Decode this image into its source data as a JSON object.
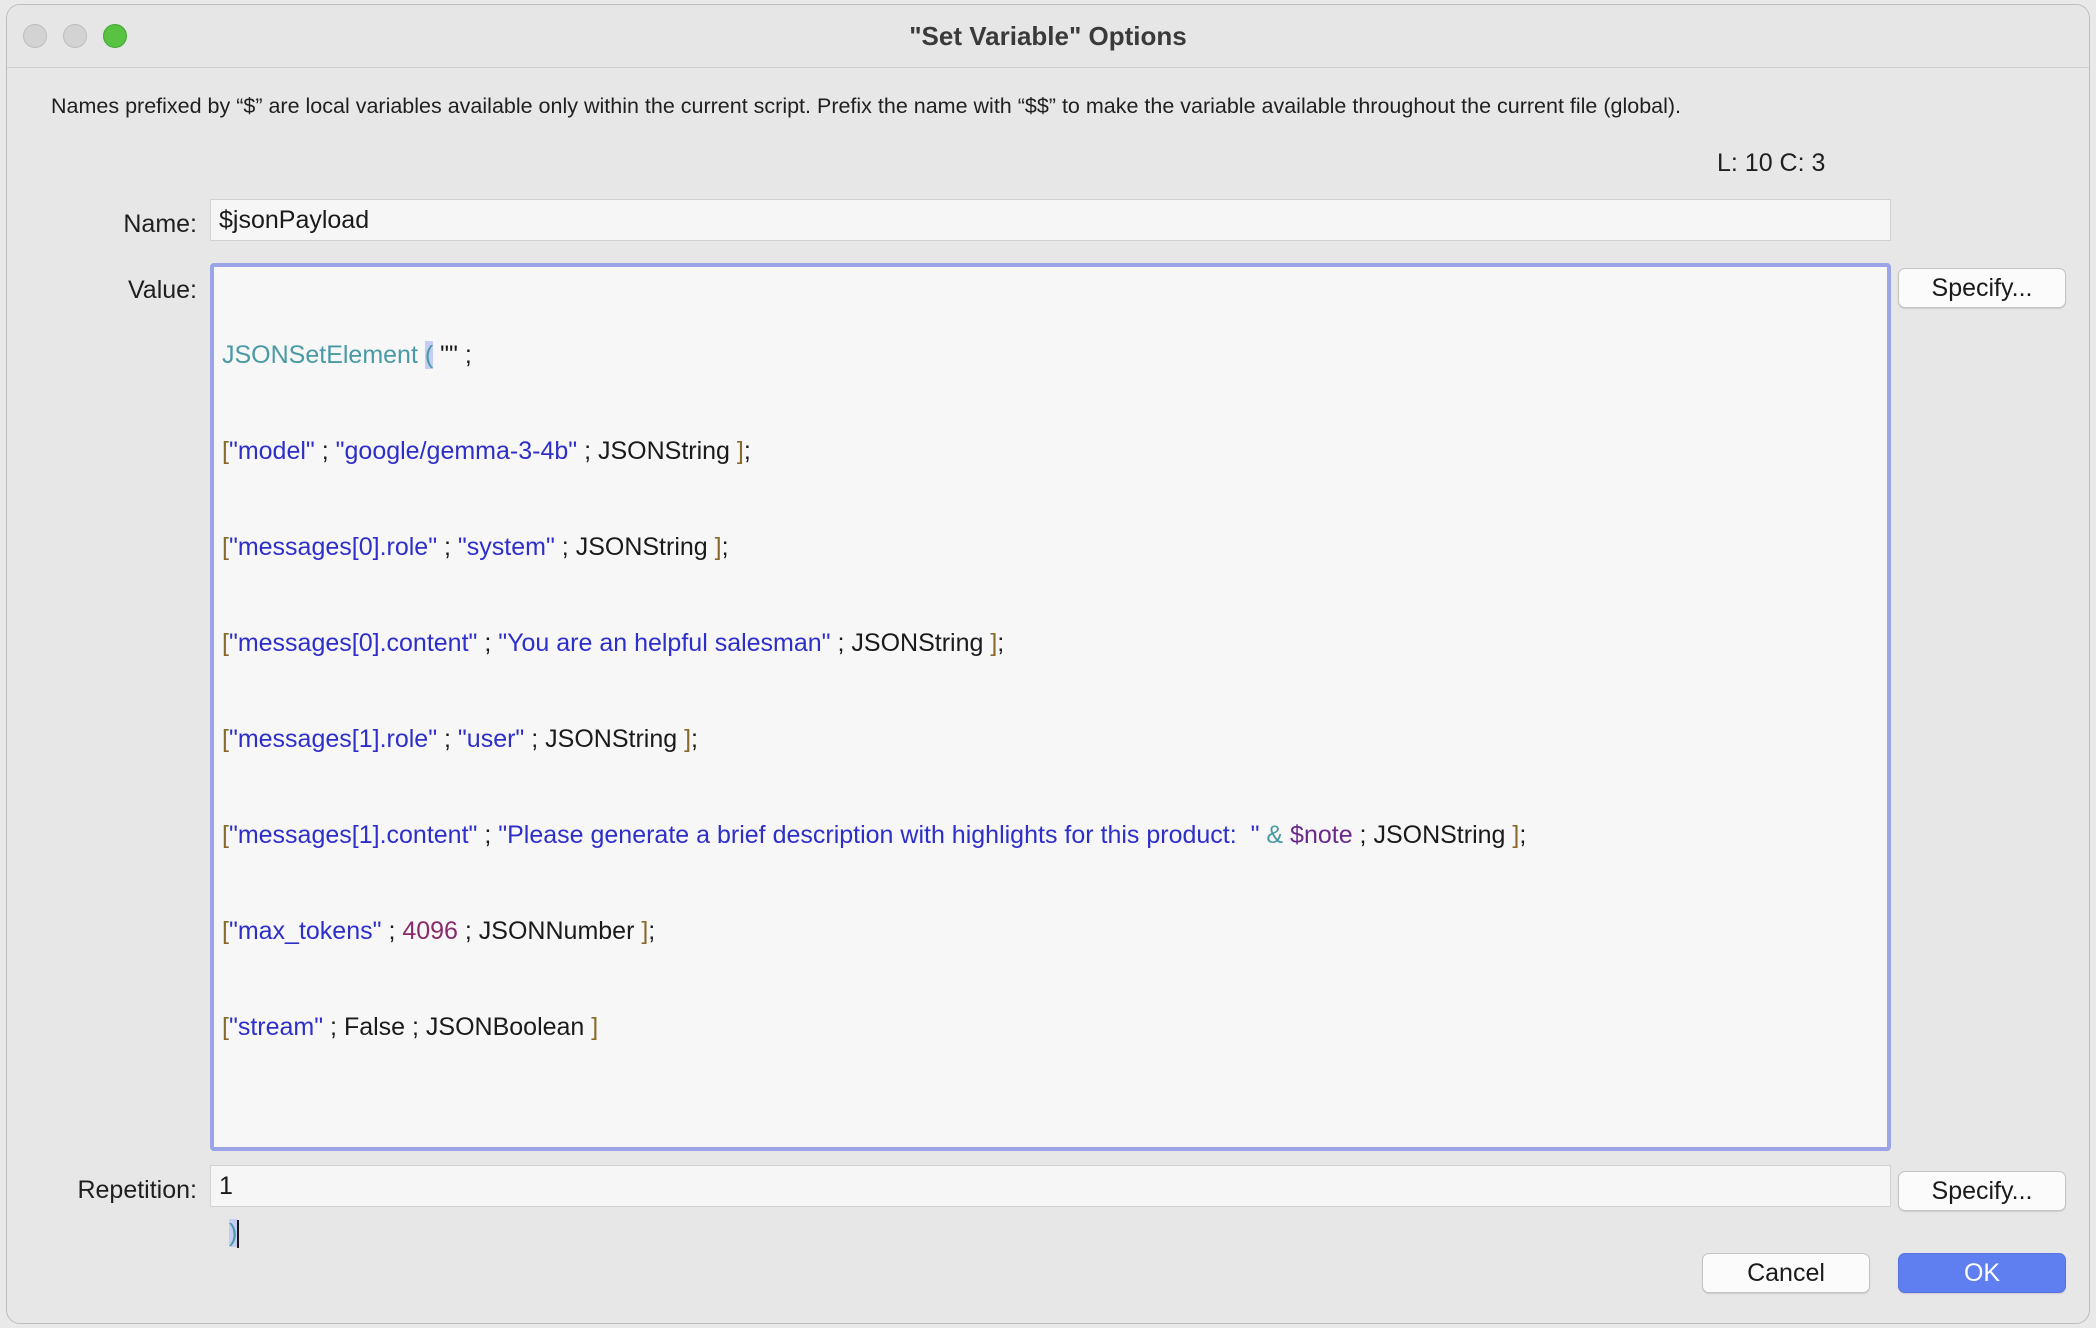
{
  "window": {
    "title": "\"Set Variable\" Options"
  },
  "info_text": "Names prefixed by “$” are local variables available only within the current script. Prefix the name with “$$” to make the variable available throughout the current file (global).",
  "cursor_position": "L: 10 C: 3",
  "name": {
    "label": "Name:",
    "value": "$jsonPayload"
  },
  "value": {
    "label": "Value:",
    "lines": [
      "JSONSetElement ( \"\" ;",
      "[\"model\" ; \"google/gemma-3-4b\" ; JSONString ];",
      "[\"messages[0].role\" ; \"system\" ; JSONString ];",
      "[\"messages[0].content\" ; \"You are an helpful salesman\" ; JSONString ];",
      "[\"messages[1].role\" ; \"user\" ; JSONString ];",
      "[\"messages[1].content\" ; \"Please generate a brief description with highlights for this product:  \" & $note ; JSONString ];",
      "[\"max_tokens\" ; 4096 ; JSONNumber ];",
      "[\"stream\" ; False ; JSONBoolean ]",
      "",
      " )"
    ]
  },
  "repetition": {
    "label": "Repetition:",
    "value": "1"
  },
  "buttons": {
    "specify_value": "Specify...",
    "specify_repetition": "Specify...",
    "cancel": "Cancel",
    "ok": "OK"
  },
  "colors": {
    "function": "#4a9aa6",
    "string": "#2e2ec8",
    "number": "#8a2a6a",
    "variable": "#6a2a8a",
    "bracket": "#8a6a2a",
    "focus_ring": "#9aa4e6",
    "ok_button": "#5f7ff0"
  }
}
